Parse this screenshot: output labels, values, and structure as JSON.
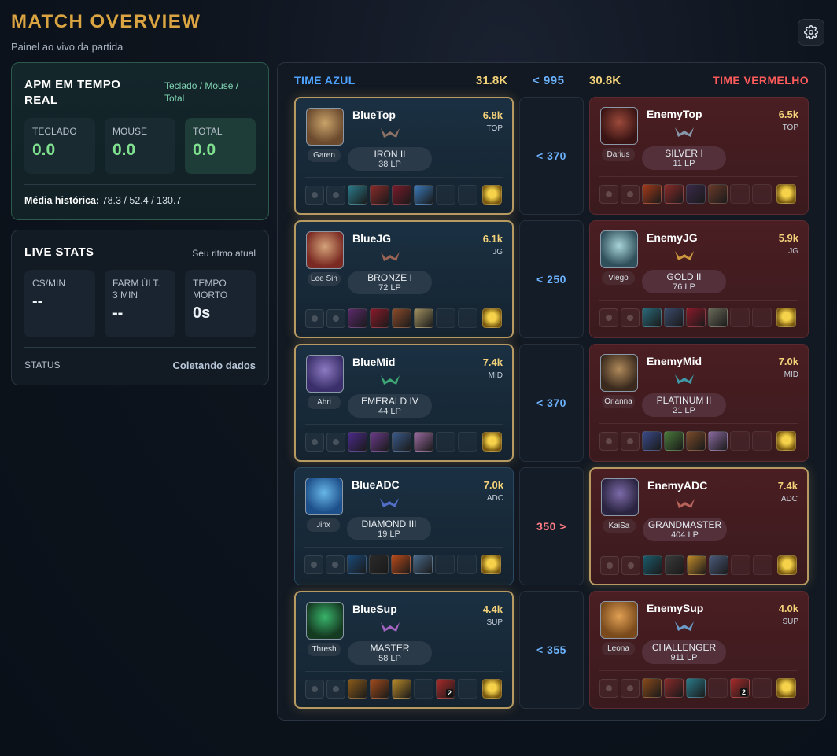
{
  "header": {
    "title": "MATCH OVERVIEW",
    "subtitle": "Painel ao vivo da partida"
  },
  "apm": {
    "title": "APM EM TEMPO REAL",
    "legend": "Teclado / Mouse / Total",
    "boxes": [
      {
        "label": "TECLADO",
        "value": "0.0"
      },
      {
        "label": "MOUSE",
        "value": "0.0"
      },
      {
        "label": "TOTAL",
        "value": "0.0"
      }
    ],
    "history_label": "Média histórica:",
    "history_value": "78.3 / 52.4 / 130.7"
  },
  "live": {
    "title": "LIVE STATS",
    "hint": "Seu ritmo atual",
    "boxes": [
      {
        "label": "CS/MIN",
        "value": "--"
      },
      {
        "label": "FARM ÚLT. 3 MIN",
        "value": "--"
      },
      {
        "label": "TEMPO MORTO",
        "value": "0s"
      }
    ],
    "status_label": "STATUS",
    "status_value": "Coletando dados"
  },
  "match": {
    "blue_team": "TIME AZUL",
    "red_team": "TIME VERMELHO",
    "blue_gold": "31.8K",
    "red_gold": "30.8K",
    "gold_diff": "< 995",
    "rows": [
      {
        "diff": "< 370",
        "diff_side": "blue",
        "blue": {
          "name": "BlueTop",
          "gold": "6.8k",
          "role": "TOP",
          "champion": "Garen",
          "rank": "IRON II",
          "lp": "38 LP",
          "lead": true
        },
        "red": {
          "name": "EnemyTop",
          "gold": "6.5k",
          "role": "TOP",
          "champion": "Darius",
          "rank": "SILVER I",
          "lp": "11 LP",
          "lead": false
        }
      },
      {
        "diff": "< 250",
        "diff_side": "blue",
        "blue": {
          "name": "BlueJG",
          "gold": "6.1k",
          "role": "JG",
          "champion": "Lee Sin",
          "rank": "BRONZE I",
          "lp": "72 LP",
          "lead": true
        },
        "red": {
          "name": "EnemyJG",
          "gold": "5.9k",
          "role": "JG",
          "champion": "Viego",
          "rank": "GOLD II",
          "lp": "76 LP",
          "lead": false
        }
      },
      {
        "diff": "< 370",
        "diff_side": "blue",
        "blue": {
          "name": "BlueMid",
          "gold": "7.4k",
          "role": "MID",
          "champion": "Ahri",
          "rank": "EMERALD IV",
          "lp": "44 LP",
          "lead": true
        },
        "red": {
          "name": "EnemyMid",
          "gold": "7.0k",
          "role": "MID",
          "champion": "Orianna",
          "rank": "PLATINUM II",
          "lp": "21 LP",
          "lead": false
        }
      },
      {
        "diff": "350 >",
        "diff_side": "red",
        "blue": {
          "name": "BlueADC",
          "gold": "7.0k",
          "role": "ADC",
          "champion": "Jinx",
          "rank": "DIAMOND III",
          "lp": "19 LP",
          "lead": false
        },
        "red": {
          "name": "EnemyADC",
          "gold": "7.4k",
          "role": "ADC",
          "champion": "KaiSa",
          "rank": "GRANDMASTER",
          "lp": "404 LP",
          "lead": true
        }
      },
      {
        "diff": "< 355",
        "diff_side": "blue",
        "blue": {
          "name": "BlueSup",
          "gold": "4.4k",
          "role": "SUP",
          "champion": "Thresh",
          "rank": "MASTER",
          "lp": "58 LP",
          "lead": true
        },
        "red": {
          "name": "EnemySup",
          "gold": "4.0k",
          "role": "SUP",
          "champion": "Leona",
          "rank": "CHALLENGER",
          "lp": "911 LP",
          "lead": false
        }
      }
    ]
  }
}
